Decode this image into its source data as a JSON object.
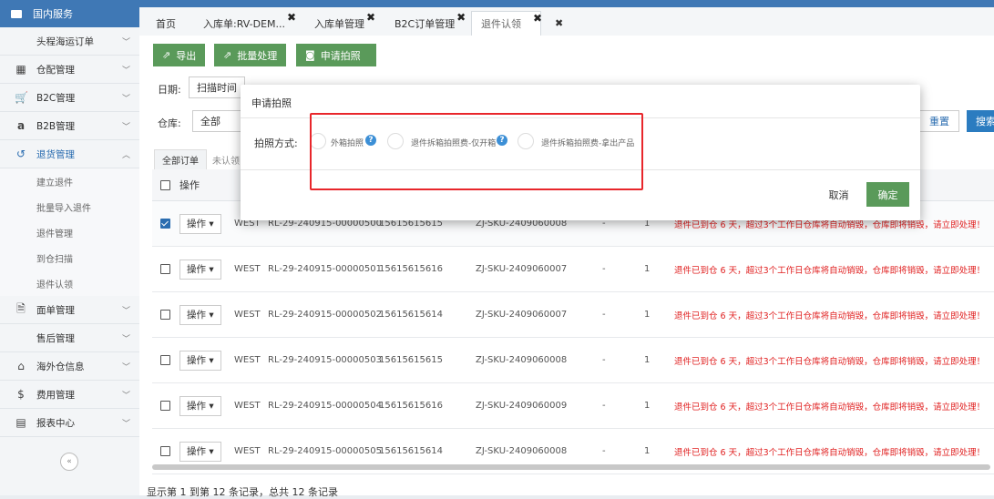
{
  "sidebar": {
    "header": "国内服务",
    "items": [
      {
        "label": "头程海运订单",
        "icon": "",
        "indent": true
      },
      {
        "label": "仓配管理",
        "icon": "grid-icon"
      },
      {
        "label": "B2C管理",
        "icon": "cart-icon"
      },
      {
        "label": "B2B管理",
        "icon": "amazon-icon"
      },
      {
        "label": "退货管理",
        "icon": "return-icon",
        "active": true
      }
    ],
    "subitems": [
      "建立退件",
      "批量导入退件",
      "退件管理",
      "到仓扫描",
      "退件认领"
    ],
    "items2": [
      {
        "label": "面单管理",
        "icon": "document-icon"
      },
      {
        "label": "售后管理",
        "icon": "",
        "indent": true
      },
      {
        "label": "海外仓信息",
        "icon": "home-icon"
      },
      {
        "label": "费用管理",
        "icon": "dollar-icon"
      },
      {
        "label": "报表中心",
        "icon": "table-icon"
      }
    ],
    "collapse_glyph": "«"
  },
  "tabs": [
    {
      "label": "首页",
      "closable": false
    },
    {
      "label": "入库单:RV-DEM...",
      "closable": true
    },
    {
      "label": "入库单管理",
      "closable": true
    },
    {
      "label": "B2C订单管理",
      "closable": true
    },
    {
      "label": "退件认领",
      "closable": true,
      "active": true
    }
  ],
  "tab_close_glyph": "✖",
  "toolbar": {
    "export": "导出",
    "batch": "批量处理",
    "photo": "申请拍照"
  },
  "filters": {
    "date_label": "日期:",
    "date_type": "扫描时间",
    "warehouse_label": "仓库:",
    "warehouse_value": "全部",
    "reset": "重置",
    "search": "搜索"
  },
  "subtabs": [
    "全部订单",
    "未认领"
  ],
  "table": {
    "headers": [
      "操作"
    ],
    "op_label": "操作 ▾",
    "rows": [
      {
        "checked": true,
        "wh": "WEST",
        "no": "RL-29-240915-00000500",
        "tel": "15615615615",
        "sku": "ZJ-SKU-2409060008",
        "dash": "-",
        "qty": "1",
        "warn": "退件已到仓 6 天，超过3个工作日仓库将自动销毁，仓库即将销毁，请立即处理！"
      },
      {
        "checked": false,
        "wh": "WEST",
        "no": "RL-29-240915-00000501",
        "tel": "15615615616",
        "sku": "ZJ-SKU-2409060007",
        "dash": "-",
        "qty": "1",
        "warn": "退件已到仓 6 天，超过3个工作日仓库将自动销毁，仓库即将销毁，请立即处理！"
      },
      {
        "checked": false,
        "wh": "WEST",
        "no": "RL-29-240915-00000502",
        "tel": "15615615614",
        "sku": "ZJ-SKU-2409060007",
        "dash": "-",
        "qty": "1",
        "warn": "退件已到仓 6 天，超过3个工作日仓库将自动销毁，仓库即将销毁，请立即处理！"
      },
      {
        "checked": false,
        "wh": "WEST",
        "no": "RL-29-240915-00000503",
        "tel": "15615615615",
        "sku": "ZJ-SKU-2409060008",
        "dash": "-",
        "qty": "1",
        "warn": "退件已到仓 6 天，超过3个工作日仓库将自动销毁，仓库即将销毁，请立即处理！"
      },
      {
        "checked": false,
        "wh": "WEST",
        "no": "RL-29-240915-00000504",
        "tel": "15615615616",
        "sku": "ZJ-SKU-2409060009",
        "dash": "-",
        "qty": "1",
        "warn": "退件已到仓 6 天，超过3个工作日仓库将自动销毁，仓库即将销毁，请立即处理！"
      },
      {
        "checked": false,
        "wh": "WEST",
        "no": "RL-29-240915-00000505",
        "tel": "15615615614",
        "sku": "ZJ-SKU-2409060008",
        "dash": "-",
        "qty": "1",
        "warn": "退件已到仓 6 天，超过3个工作日仓库将自动销毁，仓库即将销毁，请立即处理！"
      }
    ]
  },
  "footer": "显示第 1 到第 12 条记录，总共 12 条记录",
  "modal": {
    "title": "申请拍照",
    "field_label": "拍照方式:",
    "options": [
      "外箱拍照",
      "退件拆箱拍照费-仅开箱",
      "退件拆箱拍照费-拿出产品"
    ],
    "help_glyph": "?",
    "cancel": "取消",
    "ok": "确定"
  },
  "colors": {
    "brand": "#3f78b5",
    "green": "#5a9a5a",
    "warn": "#e02020",
    "highlight": "#e8262b"
  }
}
